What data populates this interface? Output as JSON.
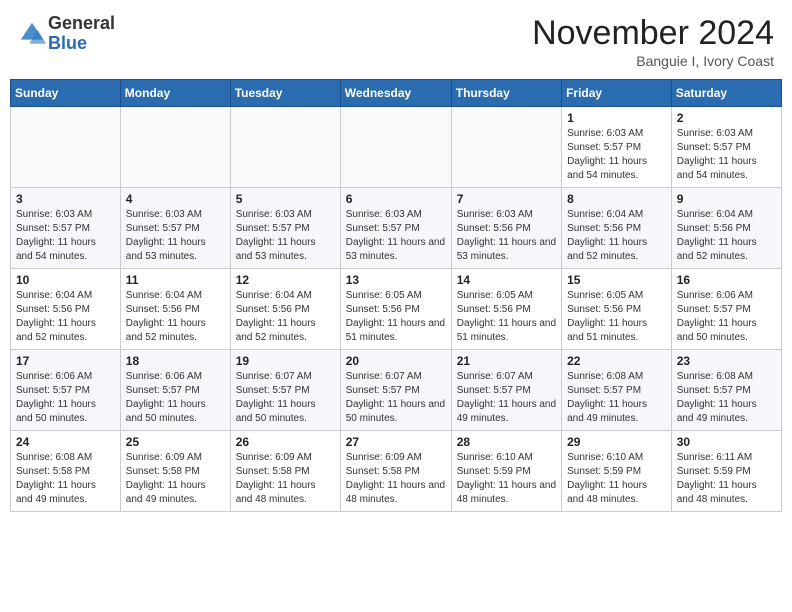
{
  "header": {
    "logo_general": "General",
    "logo_blue": "Blue",
    "month_title": "November 2024",
    "location": "Banguie I, Ivory Coast"
  },
  "weekdays": [
    "Sunday",
    "Monday",
    "Tuesday",
    "Wednesday",
    "Thursday",
    "Friday",
    "Saturday"
  ],
  "weeks": [
    [
      {
        "day": "",
        "sunrise": "",
        "sunset": "",
        "daylight": ""
      },
      {
        "day": "",
        "sunrise": "",
        "sunset": "",
        "daylight": ""
      },
      {
        "day": "",
        "sunrise": "",
        "sunset": "",
        "daylight": ""
      },
      {
        "day": "",
        "sunrise": "",
        "sunset": "",
        "daylight": ""
      },
      {
        "day": "",
        "sunrise": "",
        "sunset": "",
        "daylight": ""
      },
      {
        "day": "1",
        "sunrise": "Sunrise: 6:03 AM",
        "sunset": "Sunset: 5:57 PM",
        "daylight": "Daylight: 11 hours and 54 minutes."
      },
      {
        "day": "2",
        "sunrise": "Sunrise: 6:03 AM",
        "sunset": "Sunset: 5:57 PM",
        "daylight": "Daylight: 11 hours and 54 minutes."
      }
    ],
    [
      {
        "day": "3",
        "sunrise": "Sunrise: 6:03 AM",
        "sunset": "Sunset: 5:57 PM",
        "daylight": "Daylight: 11 hours and 54 minutes."
      },
      {
        "day": "4",
        "sunrise": "Sunrise: 6:03 AM",
        "sunset": "Sunset: 5:57 PM",
        "daylight": "Daylight: 11 hours and 53 minutes."
      },
      {
        "day": "5",
        "sunrise": "Sunrise: 6:03 AM",
        "sunset": "Sunset: 5:57 PM",
        "daylight": "Daylight: 11 hours and 53 minutes."
      },
      {
        "day": "6",
        "sunrise": "Sunrise: 6:03 AM",
        "sunset": "Sunset: 5:57 PM",
        "daylight": "Daylight: 11 hours and 53 minutes."
      },
      {
        "day": "7",
        "sunrise": "Sunrise: 6:03 AM",
        "sunset": "Sunset: 5:56 PM",
        "daylight": "Daylight: 11 hours and 53 minutes."
      },
      {
        "day": "8",
        "sunrise": "Sunrise: 6:04 AM",
        "sunset": "Sunset: 5:56 PM",
        "daylight": "Daylight: 11 hours and 52 minutes."
      },
      {
        "day": "9",
        "sunrise": "Sunrise: 6:04 AM",
        "sunset": "Sunset: 5:56 PM",
        "daylight": "Daylight: 11 hours and 52 minutes."
      }
    ],
    [
      {
        "day": "10",
        "sunrise": "Sunrise: 6:04 AM",
        "sunset": "Sunset: 5:56 PM",
        "daylight": "Daylight: 11 hours and 52 minutes."
      },
      {
        "day": "11",
        "sunrise": "Sunrise: 6:04 AM",
        "sunset": "Sunset: 5:56 PM",
        "daylight": "Daylight: 11 hours and 52 minutes."
      },
      {
        "day": "12",
        "sunrise": "Sunrise: 6:04 AM",
        "sunset": "Sunset: 5:56 PM",
        "daylight": "Daylight: 11 hours and 52 minutes."
      },
      {
        "day": "13",
        "sunrise": "Sunrise: 6:05 AM",
        "sunset": "Sunset: 5:56 PM",
        "daylight": "Daylight: 11 hours and 51 minutes."
      },
      {
        "day": "14",
        "sunrise": "Sunrise: 6:05 AM",
        "sunset": "Sunset: 5:56 PM",
        "daylight": "Daylight: 11 hours and 51 minutes."
      },
      {
        "day": "15",
        "sunrise": "Sunrise: 6:05 AM",
        "sunset": "Sunset: 5:56 PM",
        "daylight": "Daylight: 11 hours and 51 minutes."
      },
      {
        "day": "16",
        "sunrise": "Sunrise: 6:06 AM",
        "sunset": "Sunset: 5:57 PM",
        "daylight": "Daylight: 11 hours and 50 minutes."
      }
    ],
    [
      {
        "day": "17",
        "sunrise": "Sunrise: 6:06 AM",
        "sunset": "Sunset: 5:57 PM",
        "daylight": "Daylight: 11 hours and 50 minutes."
      },
      {
        "day": "18",
        "sunrise": "Sunrise: 6:06 AM",
        "sunset": "Sunset: 5:57 PM",
        "daylight": "Daylight: 11 hours and 50 minutes."
      },
      {
        "day": "19",
        "sunrise": "Sunrise: 6:07 AM",
        "sunset": "Sunset: 5:57 PM",
        "daylight": "Daylight: 11 hours and 50 minutes."
      },
      {
        "day": "20",
        "sunrise": "Sunrise: 6:07 AM",
        "sunset": "Sunset: 5:57 PM",
        "daylight": "Daylight: 11 hours and 50 minutes."
      },
      {
        "day": "21",
        "sunrise": "Sunrise: 6:07 AM",
        "sunset": "Sunset: 5:57 PM",
        "daylight": "Daylight: 11 hours and 49 minutes."
      },
      {
        "day": "22",
        "sunrise": "Sunrise: 6:08 AM",
        "sunset": "Sunset: 5:57 PM",
        "daylight": "Daylight: 11 hours and 49 minutes."
      },
      {
        "day": "23",
        "sunrise": "Sunrise: 6:08 AM",
        "sunset": "Sunset: 5:57 PM",
        "daylight": "Daylight: 11 hours and 49 minutes."
      }
    ],
    [
      {
        "day": "24",
        "sunrise": "Sunrise: 6:08 AM",
        "sunset": "Sunset: 5:58 PM",
        "daylight": "Daylight: 11 hours and 49 minutes."
      },
      {
        "day": "25",
        "sunrise": "Sunrise: 6:09 AM",
        "sunset": "Sunset: 5:58 PM",
        "daylight": "Daylight: 11 hours and 49 minutes."
      },
      {
        "day": "26",
        "sunrise": "Sunrise: 6:09 AM",
        "sunset": "Sunset: 5:58 PM",
        "daylight": "Daylight: 11 hours and 48 minutes."
      },
      {
        "day": "27",
        "sunrise": "Sunrise: 6:09 AM",
        "sunset": "Sunset: 5:58 PM",
        "daylight": "Daylight: 11 hours and 48 minutes."
      },
      {
        "day": "28",
        "sunrise": "Sunrise: 6:10 AM",
        "sunset": "Sunset: 5:59 PM",
        "daylight": "Daylight: 11 hours and 48 minutes."
      },
      {
        "day": "29",
        "sunrise": "Sunrise: 6:10 AM",
        "sunset": "Sunset: 5:59 PM",
        "daylight": "Daylight: 11 hours and 48 minutes."
      },
      {
        "day": "30",
        "sunrise": "Sunrise: 6:11 AM",
        "sunset": "Sunset: 5:59 PM",
        "daylight": "Daylight: 11 hours and 48 minutes."
      }
    ]
  ]
}
